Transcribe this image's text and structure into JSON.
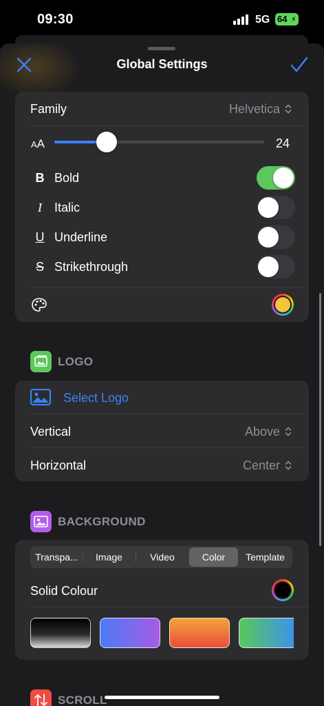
{
  "status": {
    "time": "09:30",
    "network": "5G",
    "battery": "64"
  },
  "nav": {
    "title": "Global Settings",
    "close_icon": "close-x-icon",
    "done_icon": "checkmark-icon"
  },
  "font": {
    "family_label": "Family",
    "family_value": "Helvetica",
    "size_icon_text": "AA",
    "size_value": "24",
    "size_slider_fraction": 0.25,
    "styles": [
      {
        "icon": "B",
        "label": "Bold",
        "on": true
      },
      {
        "icon": "I",
        "label": "Italic",
        "on": false
      },
      {
        "icon": "U",
        "label": "Underline",
        "on": false
      },
      {
        "icon": "S",
        "label": "Strikethrough",
        "on": false
      }
    ],
    "color_row_icon": "palette-icon",
    "color_value": "#f2c53d"
  },
  "logo": {
    "section_title": "LOGO",
    "select_label": "Select Logo",
    "vertical_label": "Vertical",
    "vertical_value": "Above",
    "horizontal_label": "Horizontal",
    "horizontal_value": "Center"
  },
  "background": {
    "section_title": "BACKGROUND",
    "tabs": [
      "Transpa...",
      "Image",
      "Video",
      "Color",
      "Template"
    ],
    "active_tab": "Color",
    "solid_label": "Solid Colour",
    "solid_value": "#000000",
    "swatches": [
      "black-gradient",
      "blue-purple-gradient",
      "orange-red-gradient",
      "green-blue-gradient"
    ]
  },
  "scroll": {
    "section_title": "SCROLL"
  },
  "colors": {
    "accent": "#3b82f6",
    "toggle_on": "#5ac85a",
    "logo_icon_bg": "#5ac85a",
    "background_icon_bg": "#b35ee8",
    "scroll_icon_bg": "#f24b44"
  }
}
